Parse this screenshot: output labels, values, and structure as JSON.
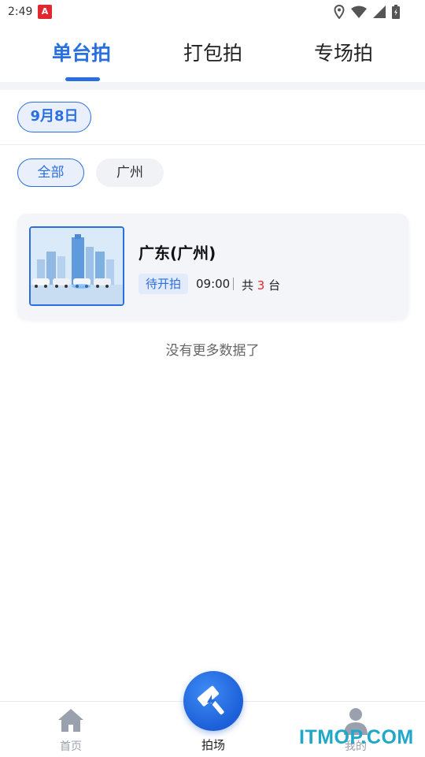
{
  "status_bar": {
    "time": "2:49",
    "app_badge": "A"
  },
  "tabs": [
    {
      "label": "单台拍",
      "active": true
    },
    {
      "label": "打包拍",
      "active": false
    },
    {
      "label": "专场拍",
      "active": false
    }
  ],
  "date_chip": "9月8日",
  "filters": [
    {
      "label": "全部",
      "active": true
    },
    {
      "label": "广州",
      "active": false
    }
  ],
  "auction_card": {
    "title": "广东(广州)",
    "status": "待开拍",
    "time": "09:00",
    "count_prefix": "共",
    "count": "3",
    "count_suffix": "台"
  },
  "list_end_text": "没有更多数据了",
  "bottom_nav": {
    "home_label": "首页",
    "center_label": "拍场",
    "me_label": "我的"
  },
  "watermark": "ITMOP.COM",
  "colors": {
    "accent": "#2a6fe0",
    "count_highlight": "#e0282e"
  }
}
